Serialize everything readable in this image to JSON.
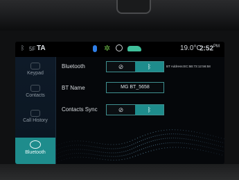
{
  "status_bar": {
    "signal_label": "5F",
    "ta_label": "TA",
    "temperature": "19.0°C",
    "time": "2:52",
    "ampm": "PM"
  },
  "sidebar": {
    "items": [
      {
        "label": "Keypad",
        "icon": "keypad-icon"
      },
      {
        "label": "Contacts",
        "icon": "contacts-icon"
      },
      {
        "label": "Call History",
        "icon": "call-history-icon"
      },
      {
        "label": "Bluetooth",
        "icon": "bluetooth-icon",
        "active": true
      }
    ]
  },
  "settings": {
    "bluetooth_label": "Bluetooth",
    "bluetooth_state": "on",
    "bt_address": "BT Address:EC:5B:73:12:56:58",
    "bt_name_label": "BT Name",
    "bt_name_value": "MG BT_5658",
    "contacts_sync_label": "Contacts Sync",
    "contacts_sync_state": "on",
    "off_symbol": "⊘",
    "on_symbol": "ᛒ"
  },
  "colors": {
    "accent": "#1e8c8c",
    "background": "#05070a",
    "text": "#d6dade"
  }
}
